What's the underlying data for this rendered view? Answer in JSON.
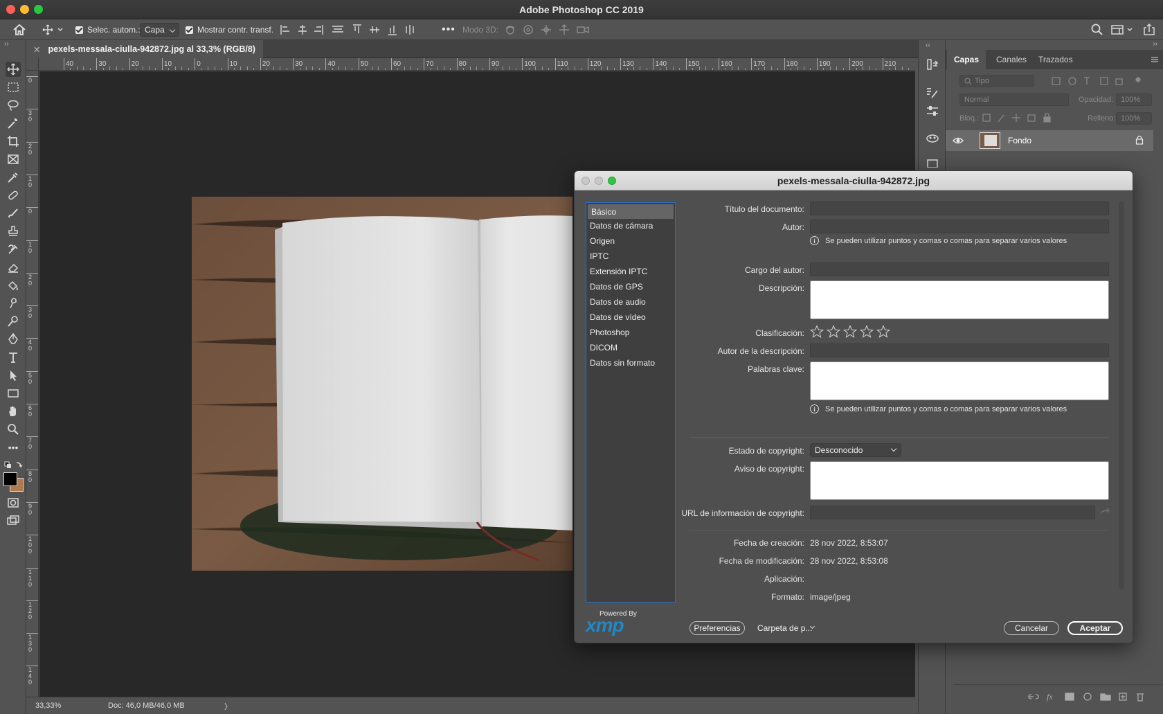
{
  "app": {
    "title": "Adobe Photoshop CC 2019"
  },
  "options_bar": {
    "auto_select_label": "Selec. autom.:",
    "auto_select_value": "Capa",
    "show_transform_label": "Mostrar contr. transf.",
    "mode3d_label": "Modo 3D:"
  },
  "document": {
    "tab_title": "pexels-messala-ciulla-942872.jpg al 33,3% (RGB/8)",
    "zoom": "33,33%",
    "doc_info": "Doc: 46,0 MB/46,0 MB"
  },
  "rulers": {
    "horizontal": [
      "40",
      "30",
      "20",
      "10",
      "0",
      "10",
      "20",
      "30",
      "40",
      "50",
      "60",
      "70",
      "80",
      "90",
      "100",
      "110",
      "120",
      "130",
      "140",
      "150",
      "160",
      "170",
      "180",
      "190",
      "200",
      "210"
    ],
    "vertical": [
      "0",
      "3\n0",
      "2\n0",
      "1\n0",
      "0",
      "1\n0",
      "2\n0",
      "3\n0",
      "4\n0",
      "5\n0",
      "6\n0",
      "7\n0",
      "8\n0",
      "9\n0",
      "1\n0\n0",
      "1\n1\n0",
      "1\n2\n0",
      "1\n3\n0",
      "1\n4\n0"
    ]
  },
  "layers_panel": {
    "tabs": [
      "Capas",
      "Canales",
      "Trazados"
    ],
    "filter_placeholder": "Tipo",
    "blend_mode": "Normal",
    "opacity_label": "Opacidad:",
    "opacity_value": "100%",
    "lock_label": "Bloq.:",
    "fill_label": "Relleno:",
    "fill_value": "100%",
    "layer_name": "Fondo"
  },
  "dialog": {
    "title": "pexels-messala-ciulla-942872.jpg",
    "categories": [
      "Básico",
      "Datos de cámara",
      "Origen",
      "IPTC",
      "Extensión IPTC",
      "Datos de GPS",
      "Datos de audio",
      "Datos de vídeo",
      "Photoshop",
      "DICOM",
      "Datos sin formato"
    ],
    "selected_category": "Básico",
    "fields": {
      "doc_title_label": "Título del documento:",
      "author_label": "Autor:",
      "hint_separator": "Se pueden utilizar puntos y comas o comas para separar varios valores",
      "author_title_label": "Cargo del autor:",
      "description_label": "Descripción:",
      "rating_label": "Clasificación:",
      "rating_value": 0,
      "description_author_label": "Autor de la descripción:",
      "keywords_label": "Palabras clave:",
      "copyright_status_label": "Estado de copyright:",
      "copyright_status_value": "Desconocido",
      "copyright_notice_label": "Aviso de copyright:",
      "copyright_url_label": "URL de información de copyright:",
      "created_label": "Fecha de creación:",
      "created_value": "28 nov 2022, 8:53:07",
      "modified_label": "Fecha de modificación:",
      "modified_value": "28 nov 2022, 8:53:08",
      "application_label": "Aplicación:",
      "application_value": "",
      "format_label": "Formato:",
      "format_value": "image/jpeg"
    },
    "powered_by": "Powered By",
    "xmp_logo": "xmp",
    "buttons": {
      "preferences": "Preferencias",
      "folder": "Carpeta de p...",
      "cancel": "Cancelar",
      "ok": "Aceptar"
    }
  },
  "colors": {
    "panel_bg": "#535353",
    "canvas_bg": "#282828",
    "dialog_bg": "#4f4f4f",
    "selection_blue": "#2a6fc8",
    "xmp_blue": "#1e88c8"
  }
}
